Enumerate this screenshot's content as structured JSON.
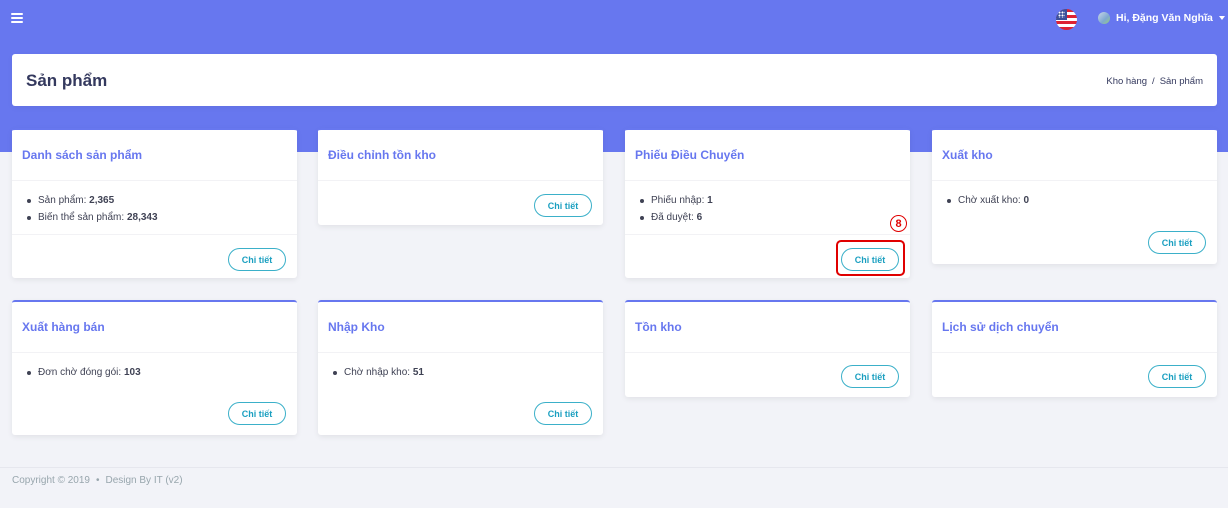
{
  "header": {
    "greeting": "Hi, Đặng Văn Nghĩa",
    "menu_icon": "hamburger-menu-icon",
    "flag_icon": "us-flag-icon"
  },
  "page": {
    "title": "Sản phẩm",
    "breadcrumb": [
      "Kho hàng",
      "/",
      "Sản phẩm"
    ]
  },
  "cards": [
    {
      "title": "Danh sách sản phẩm",
      "items": [
        {
          "label": "Sản phẩm: ",
          "value": "2,365"
        },
        {
          "label": "Biến thể sản phẩm: ",
          "value": "28,343"
        }
      ],
      "button": "Chi tiết"
    },
    {
      "title": "Điều chỉnh tồn kho",
      "items": [],
      "button": "Chi tiết"
    },
    {
      "title": "Phiếu Điều Chuyển",
      "items": [
        {
          "label": "Phiếu nhập: ",
          "value": "1"
        },
        {
          "label": "Đã duyệt: ",
          "value": "6"
        }
      ],
      "button": "Chi tiết"
    },
    {
      "title": "Xuất kho",
      "items": [
        {
          "label": "Chờ xuất kho: ",
          "value": "0"
        }
      ],
      "button": "Chi tiết"
    },
    {
      "title": "Xuất hàng bán",
      "items": [
        {
          "label": "Đơn chờ đóng gói: ",
          "value": "103"
        }
      ],
      "button": "Chi tiết"
    },
    {
      "title": "Nhập Kho",
      "items": [
        {
          "label": "Chờ nhập kho: ",
          "value": "51"
        }
      ],
      "button": "Chi tiết"
    },
    {
      "title": "Tồn kho",
      "items": [],
      "button": "Chi tiết"
    },
    {
      "title": "Lịch sử dịch chuyển",
      "items": [],
      "button": "Chi tiết"
    }
  ],
  "annotation": {
    "step_number": "8"
  },
  "footer": {
    "copyright": "Copyright © 2019",
    "separator": "•",
    "design": "Design By IT (v2)"
  },
  "colors": {
    "primary": "#6777ef",
    "button_border": "#3bb0c9",
    "annotation": "#e00000",
    "background": "#f2f3f8"
  }
}
